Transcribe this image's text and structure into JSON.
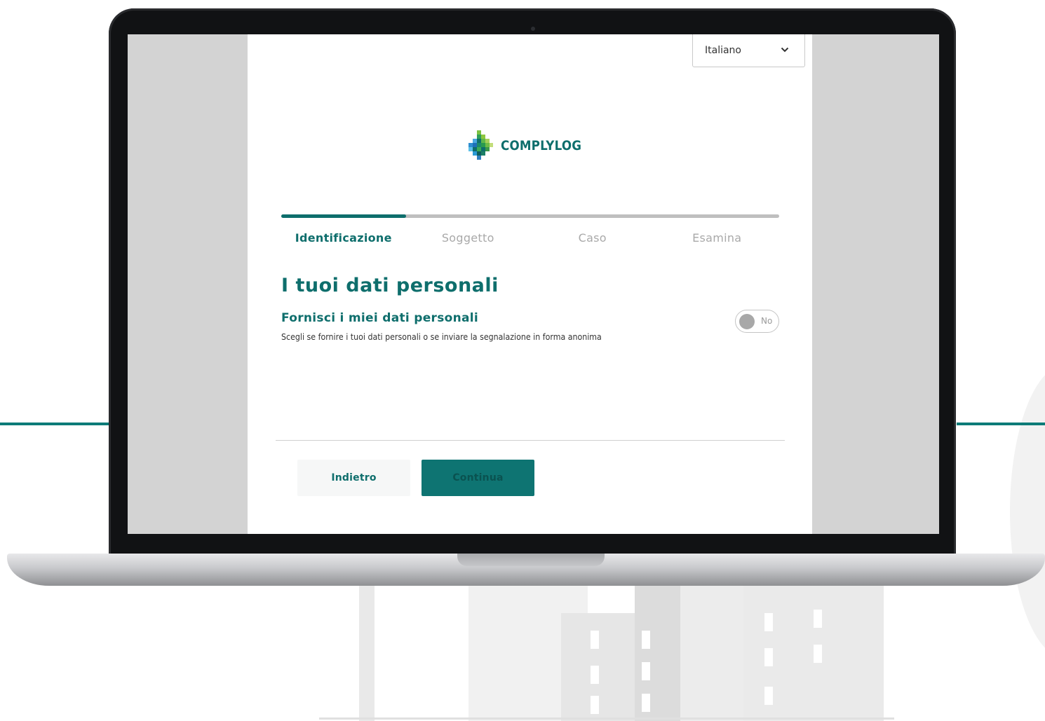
{
  "language_select": {
    "value": "Italiano",
    "icon": "chevron-down-icon"
  },
  "brand": {
    "name": "COMPLYLOG",
    "color": "#0e6e6c"
  },
  "progress": {
    "current_step": 1,
    "total_steps": 4,
    "fraction": 0.25
  },
  "steps": [
    {
      "label": "Identificazione",
      "active": true
    },
    {
      "label": "Soggetto",
      "active": false
    },
    {
      "label": "Caso",
      "active": false
    },
    {
      "label": "Esamina",
      "active": false
    }
  ],
  "form": {
    "title": "I tuoi dati personali",
    "field_title": "Fornisci i miei dati personali",
    "field_help": "Scegli se fornire i tuoi dati personali o se inviare la segnalazione in forma anonima",
    "toggle": {
      "label": "No",
      "checked": false
    }
  },
  "actions": {
    "back_label": "Indietro",
    "continue_label": "Continua"
  },
  "colors": {
    "accent": "#0e6e6c",
    "button_primary": "#0e7472",
    "screen_bg": "#d3d3d3"
  }
}
